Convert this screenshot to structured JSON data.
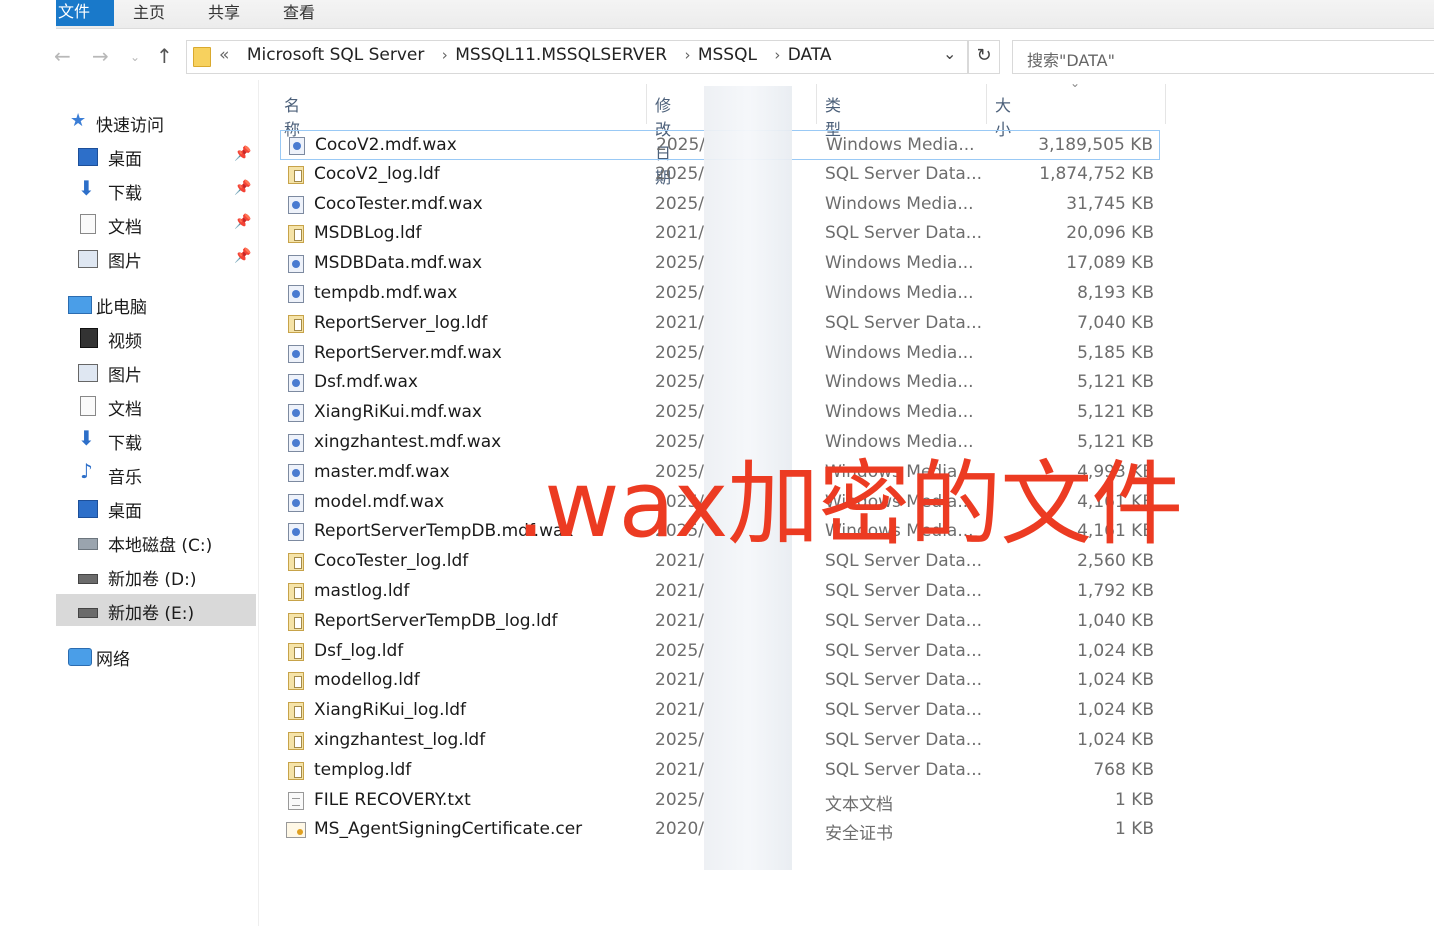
{
  "ribbon": {
    "tabs": [
      "文件",
      "主页",
      "共享",
      "查看"
    ]
  },
  "address": {
    "overflow": "«",
    "crumbs": [
      "Microsoft SQL Server",
      "MSSQL11.MSSQLSERVER",
      "MSSQL",
      "DATA"
    ],
    "search_placeholder": "搜索\"DATA\""
  },
  "sidebar": {
    "items": [
      {
        "label": "快速访问",
        "icon": "star-icon",
        "level": 0
      },
      {
        "label": "桌面",
        "icon": "desktop-icon",
        "level": 1,
        "pinned": true
      },
      {
        "label": "下载",
        "icon": "download-icon",
        "level": 1,
        "pinned": true
      },
      {
        "label": "文档",
        "icon": "document-icon",
        "level": 1,
        "pinned": true
      },
      {
        "label": "图片",
        "icon": "pictures-icon",
        "level": 1,
        "pinned": true
      },
      {
        "label": "此电脑",
        "icon": "computer-icon",
        "level": 0
      },
      {
        "label": "视频",
        "icon": "video-icon",
        "level": 1
      },
      {
        "label": "图片",
        "icon": "pictures-icon",
        "level": 1
      },
      {
        "label": "文档",
        "icon": "document-icon",
        "level": 1
      },
      {
        "label": "下载",
        "icon": "download-icon",
        "level": 1
      },
      {
        "label": "音乐",
        "icon": "music-icon",
        "level": 1
      },
      {
        "label": "桌面",
        "icon": "desktop-icon",
        "level": 1
      },
      {
        "label": "本地磁盘 (C:)",
        "icon": "drive-icon",
        "level": 1
      },
      {
        "label": "新加卷 (D:)",
        "icon": "drive-icon",
        "level": 1
      },
      {
        "label": "新加卷 (E:)",
        "icon": "drive-icon",
        "level": 1,
        "selected": true
      },
      {
        "label": "网络",
        "icon": "network-icon",
        "level": 0
      }
    ]
  },
  "columns": {
    "name": "名称",
    "date": "修改日期",
    "type": "类型",
    "size": "大小"
  },
  "files": [
    {
      "name": "CocoV2.mdf.wax",
      "date": "2025/",
      "type": "Windows Media...",
      "size": "3,189,505 KB",
      "icon": "wax"
    },
    {
      "name": "CocoV2_log.ldf",
      "date": "2025/",
      "type": "SQL Server Data...",
      "size": "1,874,752 KB",
      "icon": "ldf"
    },
    {
      "name": "CocoTester.mdf.wax",
      "date": "2025/",
      "type": "Windows Media...",
      "size": "31,745 KB",
      "icon": "wax"
    },
    {
      "name": "MSDBLog.ldf",
      "date": "2021/",
      "type": "SQL Server Data...",
      "size": "20,096 KB",
      "icon": "ldf"
    },
    {
      "name": "MSDBData.mdf.wax",
      "date": "2025/",
      "type": "Windows Media...",
      "size": "17,089 KB",
      "icon": "wax"
    },
    {
      "name": "tempdb.mdf.wax",
      "date": "2025/",
      "type": "Windows Media...",
      "size": "8,193 KB",
      "icon": "wax"
    },
    {
      "name": "ReportServer_log.ldf",
      "date": "2021/",
      "type": "SQL Server Data...",
      "size": "7,040 KB",
      "icon": "ldf"
    },
    {
      "name": "ReportServer.mdf.wax",
      "date": "2025/",
      "type": "Windows Media...",
      "size": "5,185 KB",
      "icon": "wax"
    },
    {
      "name": "Dsf.mdf.wax",
      "date": "2025/",
      "type": "Windows Media...",
      "size": "5,121 KB",
      "icon": "wax"
    },
    {
      "name": "XiangRiKui.mdf.wax",
      "date": "2025/",
      "type": "Windows Media...",
      "size": "5,121 KB",
      "icon": "wax"
    },
    {
      "name": "xingzhantest.mdf.wax",
      "date": "2025/",
      "type": "Windows Media...",
      "size": "5,121 KB",
      "icon": "wax"
    },
    {
      "name": "master.mdf.wax",
      "date": "2025/",
      "type": "Windows Media...",
      "size": "4,993 KB",
      "icon": "wax"
    },
    {
      "name": "model.mdf.wax",
      "date": "2025/",
      "type": "Windows Media...",
      "size": "4,161 KB",
      "icon": "wax"
    },
    {
      "name": "ReportServerTempDB.mdf.wax",
      "date": "2025/",
      "type": "Windows Media...",
      "size": "4,161 KB",
      "icon": "wax"
    },
    {
      "name": "CocoTester_log.ldf",
      "date": "2021/",
      "type": "SQL Server Data...",
      "size": "2,560 KB",
      "icon": "ldf"
    },
    {
      "name": "mastlog.ldf",
      "date": "2021/",
      "type": "SQL Server Data...",
      "size": "1,792 KB",
      "icon": "ldf"
    },
    {
      "name": "ReportServerTempDB_log.ldf",
      "date": "2021/",
      "type": "SQL Server Data...",
      "size": "1,040 KB",
      "icon": "ldf"
    },
    {
      "name": "Dsf_log.ldf",
      "date": "2025/",
      "type": "SQL Server Data...",
      "size": "1,024 KB",
      "icon": "ldf"
    },
    {
      "name": "modellog.ldf",
      "date": "2021/",
      "type": "SQL Server Data...",
      "size": "1,024 KB",
      "icon": "ldf"
    },
    {
      "name": "XiangRiKui_log.ldf",
      "date": "2021/",
      "type": "SQL Server Data...",
      "size": "1,024 KB",
      "icon": "ldf"
    },
    {
      "name": "xingzhantest_log.ldf",
      "date": "2025/",
      "type": "SQL Server Data...",
      "size": "1,024 KB",
      "icon": "ldf"
    },
    {
      "name": "templog.ldf",
      "date": "2021/",
      "type": "SQL Server Data...",
      "size": "768 KB",
      "icon": "ldf"
    },
    {
      "name": "FILE RECOVERY.txt",
      "date": "2025/",
      "type": "文本文档",
      "size": "1 KB",
      "icon": "txt"
    },
    {
      "name": "MS_AgentSigningCertificate.cer",
      "date": "2020/",
      "type": "安全证书",
      "size": "1 KB",
      "icon": "cer"
    }
  ],
  "overlay_caption": ".wax加密的文件",
  "colors": {
    "accent": "#1979ca",
    "overlay": "#ec3b22",
    "selection": "#d9d9d9"
  }
}
